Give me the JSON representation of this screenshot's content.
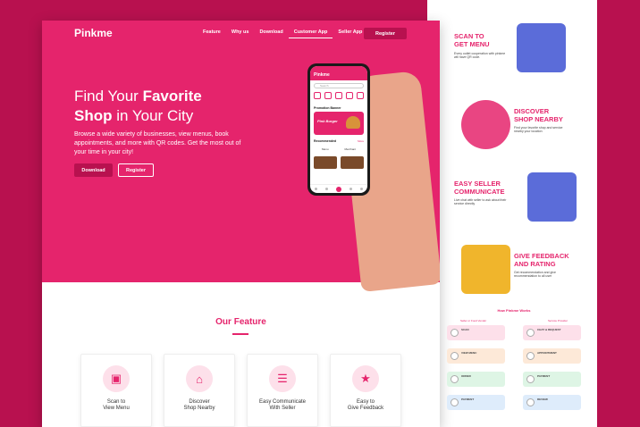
{
  "brand": "Pinkme",
  "nav": {
    "links": [
      "Feature",
      "Why us",
      "Download",
      "Customer App",
      "Seller App"
    ],
    "register": "Register"
  },
  "hero": {
    "title_pre1": "Find Your ",
    "title_bold1": "Favorite",
    "title_bold2": "Shop",
    "title_post2": " in Your City",
    "description": "Browse a wide variety of businesses, view menus, book appointments, and more with QR codes. Get the most out of your time in your city!",
    "download": "Download",
    "register": "Register"
  },
  "phone": {
    "app_name": "Pinkme",
    "search_placeholder": "Search",
    "promotion_label": "Promotion Banner",
    "banner_text": "Pink Burger",
    "recommended": "Recommended",
    "more": "More",
    "tab_menu": "Menu",
    "tab_merchant": "Merchant"
  },
  "features": {
    "title": "Our Feature",
    "cards": [
      {
        "label1": "Scan to",
        "label2": "View Menu",
        "icon": "qr-scan-icon"
      },
      {
        "label1": "Discover",
        "label2": "Shop Nearby",
        "icon": "shop-icon"
      },
      {
        "label1": "Easy Communicate",
        "label2": "With Seller",
        "icon": "chat-icon"
      },
      {
        "label1": "Easy to",
        "label2": "Give Feedback",
        "icon": "star-icon"
      }
    ]
  },
  "right_features": [
    {
      "title1": "SCAN TO",
      "title2": "GET MENU",
      "desc": "Every outlet cooperation with pinkme will have QR code."
    },
    {
      "title1": "DISCOVER",
      "title2": "SHOP NEARBY",
      "desc": "Find your favorite shop and service nearby your location"
    },
    {
      "title1": "EASY SELLER",
      "title2": "COMMUNICATE",
      "desc": "Live chat with seller to ask about their service directly"
    },
    {
      "title1": "GIVE FEEDBACK",
      "title2": "AND RATING",
      "desc": "Get recommendation and give recommendation to all user"
    }
  ],
  "works": {
    "title": "How Pinkme Works",
    "col_left": "Seller or Food Vendor",
    "col_right": "Service Provider",
    "rows": [
      [
        "SCAN",
        "CHAT & REQUEST"
      ],
      [
        "VIEW MENU",
        "APPOINTMENT"
      ],
      [
        "ORDER",
        "PAYMENT"
      ],
      [
        "PAYMENT",
        "REVIEW"
      ]
    ]
  }
}
